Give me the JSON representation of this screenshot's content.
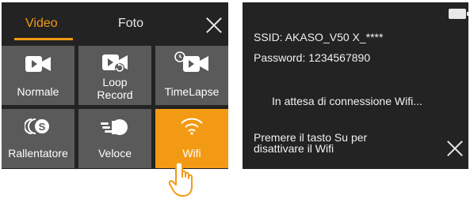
{
  "menu": {
    "tabs": [
      {
        "label": "Video",
        "active": true
      },
      {
        "label": "Foto",
        "active": false
      }
    ],
    "tiles": [
      {
        "label": "Normale",
        "icon": "video-camera-icon"
      },
      {
        "label": "Loop Record",
        "line1": "Loop",
        "line2": "Record",
        "icon": "loop-record-icon"
      },
      {
        "label": "TimeLapse",
        "icon": "timelapse-icon"
      },
      {
        "label": "Rallentatore",
        "icon": "slow-motion-icon"
      },
      {
        "label": "Veloce",
        "icon": "fast-motion-icon"
      },
      {
        "label": "Wifi",
        "icon": "wifi-icon",
        "selected": true
      }
    ],
    "accent_color": "#f39a14",
    "tile_color": "#5a5a5a"
  },
  "wifi_screen": {
    "ssid_label": "SSID:",
    "ssid_value": "AKASO_V50 X_****",
    "password_label": "Password:",
    "password_value": "1234567890",
    "status": "In attesa di connessione Wifi...",
    "hint_line1": "Premere il tasto Su per",
    "hint_line2": "disattivare il Wifi"
  }
}
